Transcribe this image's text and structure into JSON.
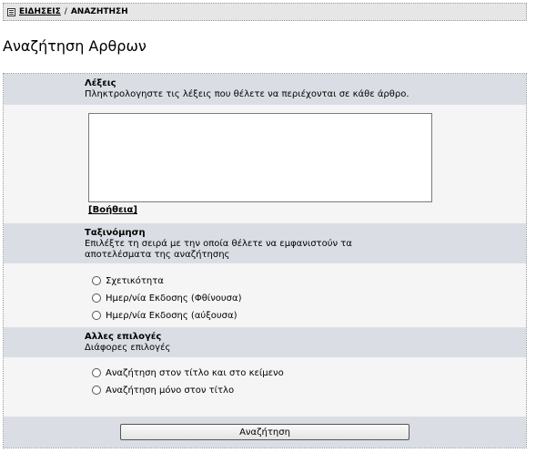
{
  "breadcrumb": {
    "link": "ΕΙΔΗΣΕΙΣ",
    "separator": "/",
    "current": "ΑΝΑΖΗΤΗΣΗ"
  },
  "page_title": "Αναζήτηση Αρθρων",
  "words": {
    "heading": "Λέξεις",
    "description": "Πληκτρολογηστε τις λέξεις που θέλετε να περιέχονται σε κάθε άρθρο.",
    "value": "",
    "help_link": "[Βοήθεια]"
  },
  "sort": {
    "heading": "Ταξινόμηση",
    "description_line1": "Επιλέξτε τη σειρά με την οποία θέλετε να εμφανιστούν τα",
    "description_line2": "αποτελέσματα της αναζήτησης",
    "options": [
      "Σχετικότητα",
      "Ημερ/νία Εκδοσης (Φθίνουσα)",
      "Ημερ/νία Εκδοσης (αύξουσα)"
    ]
  },
  "other": {
    "heading": "Αλλες επιλογές",
    "description": "Διάφορες επιλογές",
    "options": [
      "Αναζήτηση στον τίτλο και στο κείμενο",
      "Αναζήτηση μόνο στον τίτλο"
    ]
  },
  "submit_label": "Αναζήτηση"
}
